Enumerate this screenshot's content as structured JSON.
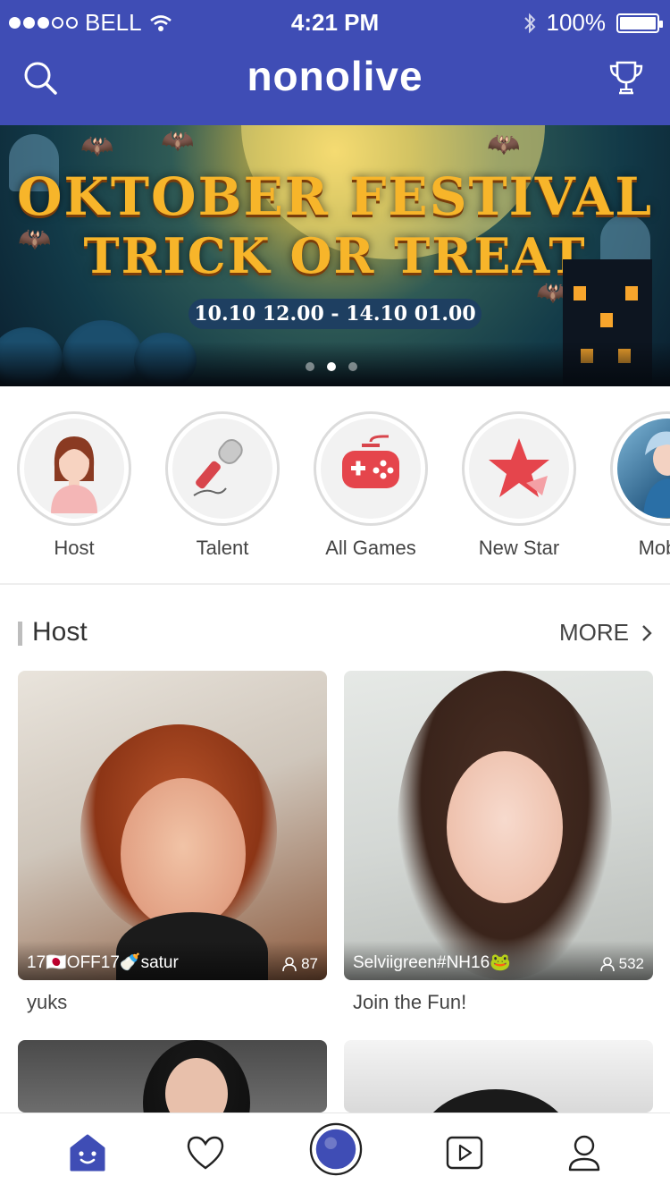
{
  "status_bar": {
    "carrier": "BELL",
    "time": "4:21 PM",
    "battery": "100%",
    "battery_level": 1.0,
    "signal_bars_filled": 3,
    "signal_bars_total": 5
  },
  "header": {
    "logo": "nonolive",
    "search_icon": "search-icon",
    "trophy_icon": "trophy-icon",
    "color": "#3f4db5"
  },
  "banner": {
    "title_line1": "OKTOBER FESTIVAL",
    "title_line2": "TRICK OR TREAT",
    "date_range": "10.10 12.00 - 14.10 01.00",
    "page_count": 3,
    "active_page": 2
  },
  "categories": [
    {
      "label": "Host",
      "icon": "host-icon"
    },
    {
      "label": "Talent",
      "icon": "microphone-icon"
    },
    {
      "label": "All Games",
      "icon": "gamepad-icon"
    },
    {
      "label": "New Star",
      "icon": "star-icon"
    },
    {
      "label": "Mobile",
      "icon": "mobile-legends-icon"
    }
  ],
  "host_section": {
    "title": "Host",
    "more_label": "MORE",
    "cards": [
      {
        "caption": "17🇯🇵OFF17🍼satur",
        "viewers": "87",
        "subtitle": "yuks"
      },
      {
        "caption": "Selviigreen#NH16🐸",
        "viewers": "532",
        "subtitle": "Join the Fun!"
      }
    ]
  },
  "bottom_nav": [
    {
      "name": "home",
      "icon": "home-icon",
      "active": true
    },
    {
      "name": "favorites",
      "icon": "heart-icon",
      "active": false
    },
    {
      "name": "go-live",
      "icon": "live-camera-icon",
      "active": false
    },
    {
      "name": "videos",
      "icon": "video-icon",
      "active": false
    },
    {
      "name": "profile",
      "icon": "profile-icon",
      "active": false
    }
  ],
  "colors": {
    "brand": "#3f4db5",
    "accent_red": "#e5454c"
  }
}
